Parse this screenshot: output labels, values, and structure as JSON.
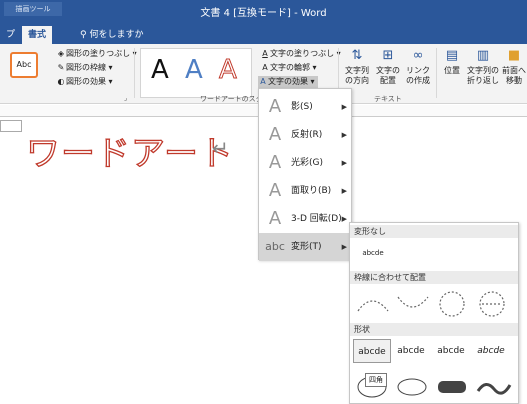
{
  "titlebar": {
    "context_tab": "描画ツール",
    "doc_title": "文書 4 [互換モード] - Word"
  },
  "tabs": {
    "partial_left": "プ",
    "active": "書式",
    "tell_me": "何をしますか"
  },
  "ribbon": {
    "shape_style_sample": "Abc",
    "shape_fill": "図形の塗りつぶし",
    "shape_outline": "図形の枠線",
    "shape_effects": "図形の効果",
    "wordart_letters": [
      "A",
      "A",
      "A"
    ],
    "wordart_group_label": "ワードアートのスタイル",
    "text_fill": "文字の塗りつぶし",
    "text_outline": "文字の輪郭",
    "text_effects": "文字の効果",
    "text_group_label": "テキスト",
    "text_direction": "文字列の方向",
    "align_text": "文字の配置",
    "create_link": "リンクの作成",
    "position": "位置",
    "wrap_text": "文字列の折り返し",
    "bring_forward": "前面へ移動"
  },
  "document": {
    "wordart_text": "ワードアート"
  },
  "effects_menu": {
    "items": [
      {
        "label": "影(S)"
      },
      {
        "label": "反射(R)"
      },
      {
        "label": "光彩(G)"
      },
      {
        "label": "面取り(B)"
      },
      {
        "label": "3-D 回転(D)"
      },
      {
        "label": "変形(T)"
      }
    ]
  },
  "transform_menu": {
    "no_transform_header": "変形なし",
    "no_transform_sample": "abcde",
    "follow_path_header": "枠線に合わせて配置",
    "warp_header": "形状",
    "warp_samples": [
      "abcde",
      "abcde",
      "abcde",
      "abcde"
    ],
    "tooltip": "四角"
  },
  "colors": {
    "accent": "#2b579a",
    "wordart_outline": "#c0392b",
    "orange_border": "#ed7d31"
  }
}
